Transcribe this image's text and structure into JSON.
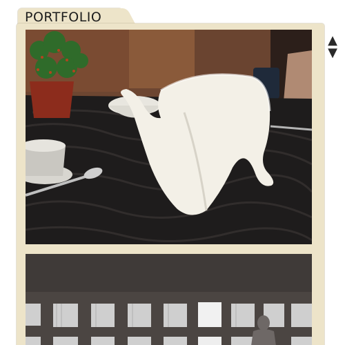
{
  "folder": {
    "tab_label": "PORTFOLIO",
    "resize_icon": "vertical-resize-icon",
    "resize_up_glyph": "▲",
    "resize_down_glyph": "▼"
  },
  "photos": [
    {
      "subject": "teapot-photo"
    },
    {
      "subject": "gallery-wall-photo"
    }
  ],
  "colors": {
    "folder": "#ede4c9",
    "tablecloth": "#1e1c1c",
    "background_wall": "#6b4630",
    "teapot": "#f3f0e7"
  }
}
